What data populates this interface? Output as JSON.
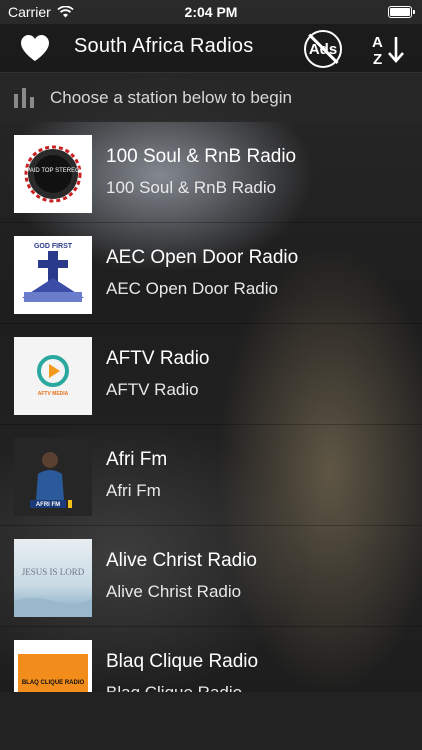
{
  "status_bar": {
    "carrier": "Carrier",
    "time": "2:04 PM"
  },
  "nav": {
    "title": "South Africa Radios",
    "ads_label": "Ads"
  },
  "subheader": {
    "text": "Choose a station below to begin"
  },
  "stations": [
    {
      "title": "100 Soul & RnB Radio",
      "subtitle": "100 Soul & RnB Radio",
      "logo_text": "PAID TOP STEREO"
    },
    {
      "title": "AEC Open Door Radio",
      "subtitle": "AEC Open Door Radio",
      "logo_text": "GOD FIRST"
    },
    {
      "title": "AFTV Radio",
      "subtitle": "AFTV Radio",
      "logo_text": "AFTV MEDIA"
    },
    {
      "title": "Afri Fm",
      "subtitle": "Afri Fm",
      "logo_text": "AFRI FM"
    },
    {
      "title": "Alive Christ Radio",
      "subtitle": "Alive Christ Radio",
      "logo_text": "JESUS IS LORD"
    },
    {
      "title": "Blaq Clique Radio",
      "subtitle": "Blaq Clique Radio",
      "logo_text": "BLAQ CLIQUE RADIO"
    }
  ]
}
